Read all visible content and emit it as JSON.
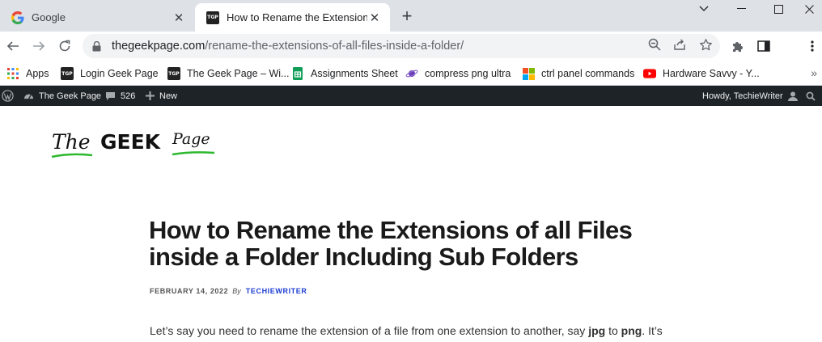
{
  "browser": {
    "tabs": [
      {
        "title": "Google",
        "favicon": "google-g-icon",
        "active": false
      },
      {
        "title": "How to Rename the Extensions o",
        "favicon": "tgp-icon",
        "active": true
      }
    ],
    "address_domain": "thegeekpage.com",
    "address_path": "/rename-the-extensions-of-all-files-inside-a-folder/",
    "bookmarks": [
      {
        "label": "Apps",
        "icon": "apps-grid-icon"
      },
      {
        "label": "Login Geek Page",
        "icon": "tgp-icon"
      },
      {
        "label": "The Geek Page – Wi...",
        "icon": "tgp-icon"
      },
      {
        "label": "Assignments Sheet",
        "icon": "sheets-icon"
      },
      {
        "label": "compress png ultra",
        "icon": "planet-icon"
      },
      {
        "label": "ctrl panel commands",
        "icon": "windows-logo-icon"
      },
      {
        "label": "Hardware Savvy - Y...",
        "icon": "youtube-icon"
      }
    ],
    "tgp_favicon_text": "TGP",
    "colors": {
      "tabstrip": "#dee1e6",
      "omnibox": "#f1f3f4"
    }
  },
  "adminbar": {
    "site_name": "The Geek Page",
    "comments_count": "526",
    "new_label": "New",
    "howdy": "Howdy, TechieWriter",
    "background": "#1d2327"
  },
  "post": {
    "logo_text": {
      "the": "The",
      "geek": "GEEK",
      "page": "Page"
    },
    "title": "How to Rename the Extensions of all Files inside a Folder Including Sub Folders",
    "date": "FEBRUARY 14, 2022",
    "by": "By",
    "author": "TECHIEWRITER",
    "excerpt_start": "Let’s say you need to rename the extension of a file from one extension to another, say ",
    "excerpt_bold1": "jpg",
    "excerpt_mid": " to ",
    "excerpt_bold2": "png",
    "excerpt_end": ". It’s",
    "author_color": "#1f3fd1"
  }
}
